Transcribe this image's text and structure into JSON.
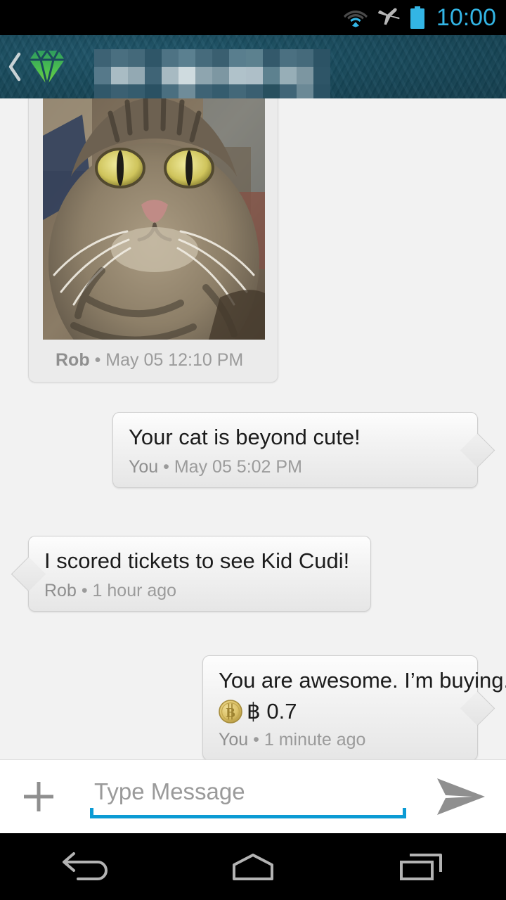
{
  "statusbar": {
    "time": "10:00",
    "icons": [
      "wifi-icon",
      "airplane-mode-icon",
      "battery-icon"
    ],
    "accent_color": "#33b5e5"
  },
  "header": {
    "back_label": "‹",
    "logo": "green-diamond-gem-logo",
    "title_redacted": true,
    "background_color": "#184a5c",
    "pixel_blocks": [
      "#3d6274",
      "#4a6f80",
      "#44697a",
      "#2f5668",
      "#4e7384",
      "#5b8090",
      "#466b7c",
      "#3a5f70",
      "#597e8e",
      "#5c818f",
      "#33596b",
      "#4b7081",
      "#456a7b",
      "#2c5365",
      "#56798a",
      "#a9bcc4",
      "#93a9b3",
      "#3f6476",
      "#a7bac2",
      "#cfdbdf",
      "#8ea5af",
      "#7d97a2",
      "#b0c2ca",
      "#aebfc8",
      "#5d818f",
      "#97aeb7",
      "#7c96a1",
      "#2e5567",
      "#31586a",
      "#3b6072",
      "#355c6e",
      "#2a5163",
      "#4a6f80",
      "#6f8c99",
      "#3e6375",
      "#355c6e",
      "#436879",
      "#3a5f71",
      "#28505f",
      "#406577",
      "#6b8996",
      "#2b5264"
    ]
  },
  "messages": [
    {
      "type": "photo",
      "side": "left",
      "photo_alt": "tabby-cat-photo",
      "author": "Rob",
      "separator": "•",
      "timestamp": "May 05 12:10 PM"
    },
    {
      "type": "text",
      "side": "right",
      "text": "Your cat is beyond cute!",
      "author": "You",
      "separator": "•",
      "timestamp": "May 05 5:02 PM"
    },
    {
      "type": "text",
      "side": "left",
      "text": "I scored tickets to see Kid Cudi!",
      "author": "Rob",
      "separator": "•",
      "timestamp": "1 hour ago"
    },
    {
      "type": "payment",
      "side": "right",
      "text": "You are awesome. I’m buying.",
      "coin_icon": "bitcoin-coin-icon",
      "coin_glyph": "B",
      "amount": "฿ 0.7",
      "author": "You",
      "separator": "•",
      "timestamp": "1 minute ago"
    }
  ],
  "composer": {
    "attach_icon": "plus-icon",
    "placeholder": "Type Message",
    "value": "",
    "send_icon": "send-paper-plane-icon",
    "underline_color": "#0c9bd4"
  },
  "navbar": {
    "back": "back-icon",
    "home": "home-icon",
    "recents": "recent-apps-icon"
  }
}
